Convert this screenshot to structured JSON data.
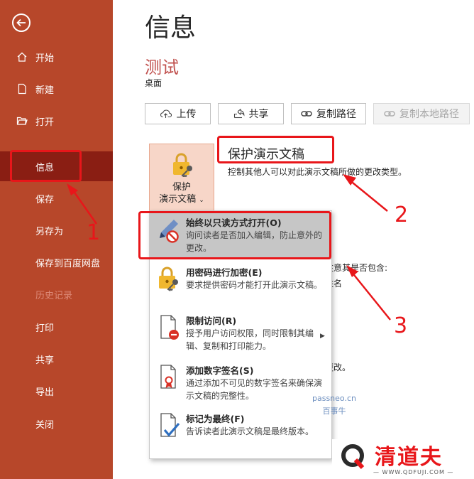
{
  "sidebar": {
    "items": [
      {
        "label": "开始",
        "icon": "home-icon"
      },
      {
        "label": "新建",
        "icon": "new-doc-icon"
      },
      {
        "label": "打开",
        "icon": "open-folder-icon"
      },
      {
        "label": "信息",
        "state": "selected"
      },
      {
        "label": "保存"
      },
      {
        "label": "另存为"
      },
      {
        "label": "保存到百度网盘"
      },
      {
        "label": "历史记录",
        "state": "disabled"
      },
      {
        "label": "打印"
      },
      {
        "label": "共享"
      },
      {
        "label": "导出"
      },
      {
        "label": "关闭"
      }
    ],
    "accent": "#b7472a",
    "active_bg": "#8a1e13"
  },
  "main": {
    "title": "信息",
    "doc_name": "测试",
    "doc_location": "桌面",
    "buttons": {
      "upload": "上传",
      "share": "共享",
      "copy_path": "复制路径",
      "copy_local_path": "复制本地路径"
    },
    "protect": {
      "button_line1": "保护",
      "button_line2": "演示文稿",
      "title": "保护演示文稿",
      "description": "控制其他人可以对此演示文稿所做的更改类型。"
    },
    "hidden_fragments": [
      "注意其是否包含:",
      "姓名",
      "更改。"
    ]
  },
  "menu": {
    "items": [
      {
        "title": "始终以只读方式打开(O)",
        "desc": "询问读者是否加入编辑，防止意外的更改。",
        "icon": "pencil-no-icon",
        "highlighted": true
      },
      {
        "title": "用密码进行加密(E)",
        "desc": "要求提供密码才能打开此演示文稿。",
        "icon": "lock-key-icon"
      },
      {
        "title": "限制访问(R)",
        "desc": "授予用户访问权限，同时限制其编辑、复制和打印能力。",
        "icon": "restrict-access-icon",
        "has_submenu": true
      },
      {
        "title": "添加数字签名(S)",
        "desc": "通过添加不可见的数字签名来确保演示文稿的完整性。",
        "icon": "digital-signature-icon"
      },
      {
        "title": "标记为最终(F)",
        "desc": "告诉读者此演示文稿是最终版本。",
        "icon": "mark-final-icon"
      }
    ]
  },
  "annotations": {
    "n1": "1",
    "n2": "2",
    "n3": "3",
    "color": "#e8161a"
  },
  "watermark": {
    "line1": "passneo.cn",
    "line2": "百事牛"
  },
  "logo": {
    "name": "清道夫",
    "url": "— WWW.QDFUJI.COM —"
  }
}
